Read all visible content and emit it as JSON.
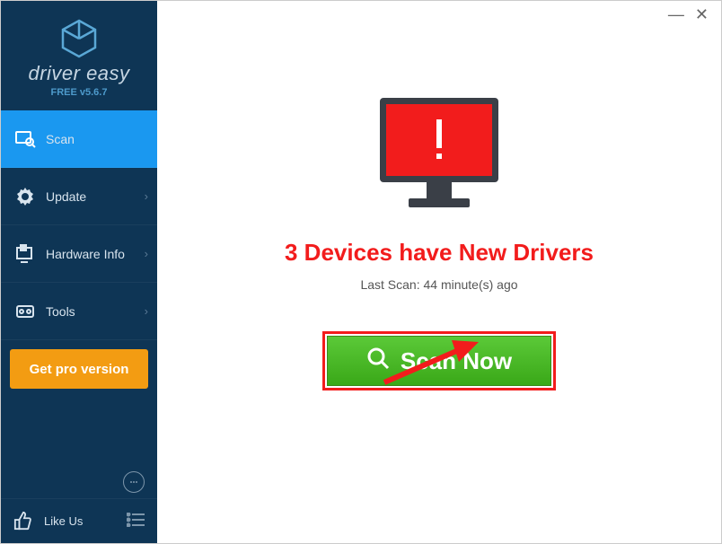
{
  "brand": {
    "name": "driver easy",
    "version": "FREE v5.6.7"
  },
  "sidebar": {
    "items": [
      {
        "label": "Scan",
        "icon": "scan-icon",
        "active": true
      },
      {
        "label": "Update",
        "icon": "gear-icon",
        "chevron": true
      },
      {
        "label": "Hardware Info",
        "icon": "hardware-icon",
        "chevron": true
      },
      {
        "label": "Tools",
        "icon": "tools-icon",
        "chevron": true
      }
    ],
    "pro_label": "Get pro version",
    "like_label": "Like Us"
  },
  "main": {
    "title": "3 Devices have New Drivers",
    "last_scan": "Last Scan: 44 minute(s) ago",
    "button": "Scan Now"
  },
  "colors": {
    "sidebar": "#0e3555",
    "active": "#1a98f0",
    "pro": "#f39c12",
    "alert": "#f21c1c",
    "scan_green": "#45b828"
  }
}
